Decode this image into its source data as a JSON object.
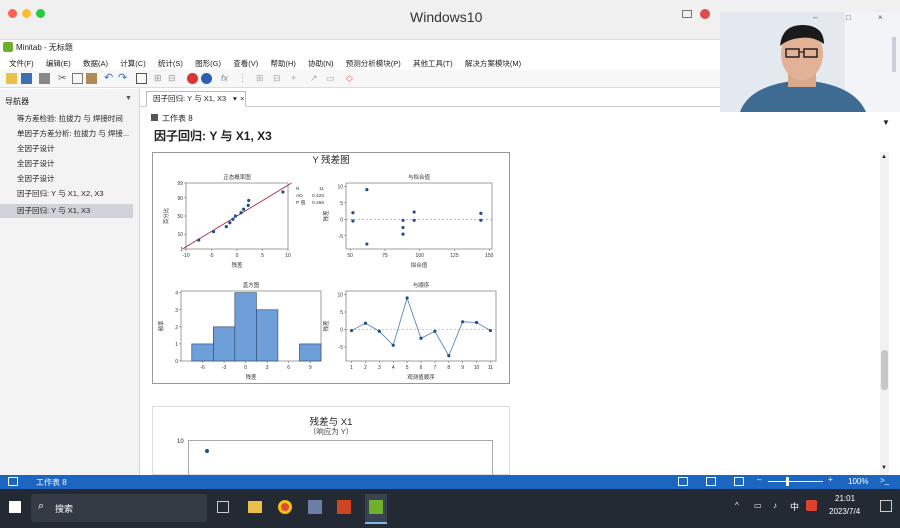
{
  "window": {
    "title": "Windows10"
  },
  "app": {
    "name": "Minitab - 无标题"
  },
  "menu": [
    "文件(F)",
    "编辑(E)",
    "数据(A)",
    "计算(C)",
    "统计(S)",
    "图形(G)",
    "查看(V)",
    "帮助(H)",
    "协助(N)",
    "预测分析模块(P)",
    "其他工具(T)",
    "解决方案模块(M)"
  ],
  "navigator": {
    "title": "导航器",
    "items": [
      "等方差检验: 拉拔力 与 焊接时间",
      "单因子方差分析: 拉拔力 与 焊接...",
      "全因子设计",
      "全因子设计",
      "全因子设计",
      "因子回归: Y 与 X1, X2, X3",
      "因子回归: Y 与 X1, X3"
    ],
    "selected_index": 6
  },
  "tab": {
    "label": "因子回归: Y 与 X1, X3"
  },
  "output": {
    "worksheet": "工作表 8",
    "heading": "因子回归: Y 与 X1, X3"
  },
  "graph1": {
    "title": "Y 残差图",
    "panels": {
      "normal": {
        "title": "正态概率图",
        "xlabel": "残差",
        "ylabel": "百分比",
        "xticks": [
          "-10",
          "-5",
          "0",
          "5",
          "10"
        ],
        "yticks": [
          "99",
          "90",
          "50",
          "10",
          "1"
        ],
        "stats": [
          [
            "N",
            "11"
          ],
          [
            "AD",
            "0.420"
          ],
          [
            "P 值",
            "0.266"
          ]
        ]
      },
      "fits": {
        "title": "与拟合值",
        "xlabel": "拟合值",
        "ylabel": "残差",
        "xticks": [
          "50",
          "75",
          "100",
          "125",
          "150"
        ],
        "yticks": [
          "10",
          "5",
          "0",
          "-5"
        ]
      },
      "histogram": {
        "title": "直方图",
        "xlabel": "残差",
        "ylabel": "频率",
        "xticks": [
          "-6",
          "-3",
          "0",
          "3",
          "6",
          "9"
        ],
        "yticks": [
          "4",
          "3",
          "2",
          "1",
          "0"
        ]
      },
      "order": {
        "title": "与顺序",
        "xlabel": "观测值顺序",
        "ylabel": "残差",
        "xticks": [
          "1",
          "2",
          "3",
          "4",
          "5",
          "6",
          "7",
          "8",
          "9",
          "10",
          "11"
        ],
        "yticks": [
          "10",
          "5",
          "0",
          "-5"
        ]
      }
    }
  },
  "graph2": {
    "title": "残差与 X1",
    "subtitle": "（响应为 Y）",
    "ytick": "10"
  },
  "chart_data": [
    {
      "type": "scatter",
      "title": "正态概率图",
      "xlabel": "残差",
      "ylabel": "百分比",
      "x": [
        -7.5,
        -4.6,
        -2.1,
        -1.4,
        -0.8,
        -0.3,
        0.8,
        1.3,
        2.2,
        2.3,
        9.0
      ],
      "y": [
        4.5,
        13.6,
        22.7,
        31.8,
        40.9,
        50,
        59.1,
        68.2,
        77.3,
        86.4,
        95.5
      ]
    },
    {
      "type": "scatter",
      "title": "与拟合值",
      "xlabel": "拟合值",
      "ylabel": "残差",
      "x": [
        52,
        52,
        62,
        62,
        88,
        88,
        88,
        96,
        96,
        144,
        144
      ],
      "y": [
        2,
        -0.5,
        9,
        -7.5,
        -0.3,
        -2.5,
        -4.5,
        2.2,
        -0.3,
        1.8,
        -0.3
      ]
    },
    {
      "type": "bar",
      "title": "直方图",
      "xlabel": "残差",
      "ylabel": "频率",
      "categories": [
        "-6",
        "-3",
        "0",
        "3",
        "6",
        "9"
      ],
      "values": [
        1,
        2,
        4,
        3,
        0,
        1
      ]
    },
    {
      "type": "line",
      "title": "与顺序",
      "xlabel": "观测值顺序",
      "ylabel": "残差",
      "x": [
        1,
        2,
        3,
        4,
        5,
        6,
        7,
        8,
        9,
        10,
        11
      ],
      "y": [
        -0.3,
        1.8,
        -0.5,
        -4.5,
        9,
        -2.5,
        -0.5,
        -7.5,
        2.2,
        2.0,
        -0.3
      ]
    }
  ],
  "status": {
    "worksheet": "工作表 8",
    "zoom": "100%"
  },
  "taskbar": {
    "search": "搜索",
    "time": "21:01",
    "date": "2023/7/4",
    "ime": "中"
  }
}
